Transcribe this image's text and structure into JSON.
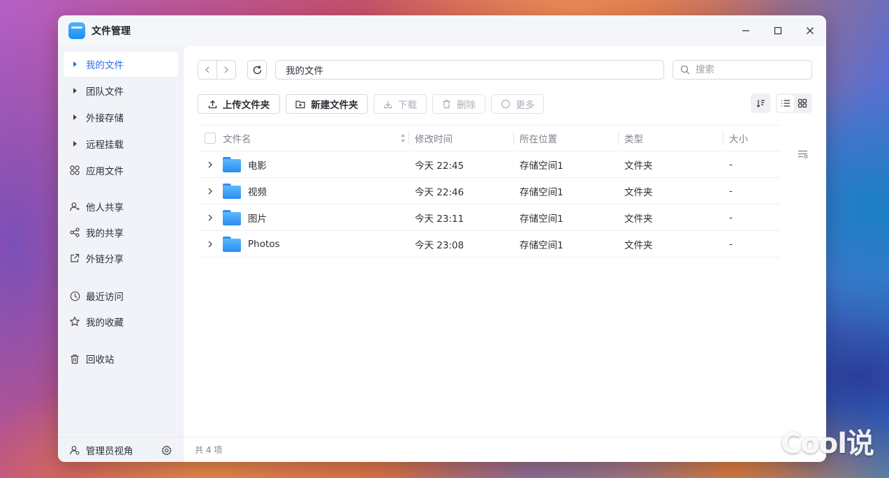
{
  "window": {
    "title": "文件管理"
  },
  "sidebar": {
    "items": [
      {
        "label": "我的文件",
        "icon": "caret-right-icon"
      },
      {
        "label": "团队文件",
        "icon": "caret-right-icon"
      },
      {
        "label": "外接存储",
        "icon": "caret-right-icon"
      },
      {
        "label": "远程挂载",
        "icon": "caret-right-icon"
      },
      {
        "label": "应用文件",
        "icon": "apps-icon"
      },
      {
        "label": "他人共享",
        "icon": "user-share-icon"
      },
      {
        "label": "我的共享",
        "icon": "share-icon"
      },
      {
        "label": "外链分享",
        "icon": "external-link-icon"
      },
      {
        "label": "最近访问",
        "icon": "clock-icon"
      },
      {
        "label": "我的收藏",
        "icon": "star-icon"
      },
      {
        "label": "回收站",
        "icon": "trash-icon"
      }
    ],
    "footer_label": "管理员视角"
  },
  "toolbar": {
    "path": "我的文件",
    "search_placeholder": "搜索",
    "upload_label": "上传文件夹",
    "new_folder_label": "新建文件夹",
    "download_label": "下载",
    "delete_label": "删除",
    "more_label": "更多"
  },
  "table": {
    "headers": {
      "name": "文件名",
      "time": "修改时间",
      "location": "所在位置",
      "type": "类型",
      "size": "大小"
    },
    "rows": [
      {
        "name": "电影",
        "time": "今天 22:45",
        "location": "存储空间1",
        "type": "文件夹",
        "size": "-"
      },
      {
        "name": "视频",
        "time": "今天 22:46",
        "location": "存储空间1",
        "type": "文件夹",
        "size": "-"
      },
      {
        "name": "图片",
        "time": "今天 23:11",
        "location": "存储空间1",
        "type": "文件夹",
        "size": "-"
      },
      {
        "name": "Photos",
        "time": "今天 23:08",
        "location": "存储空间1",
        "type": "文件夹",
        "size": "-"
      }
    ]
  },
  "status": {
    "count_text": "共 4 项"
  },
  "watermark": "Cool说",
  "colors": {
    "accent": "#2f6fe6",
    "folder": "#2a8cf0"
  }
}
